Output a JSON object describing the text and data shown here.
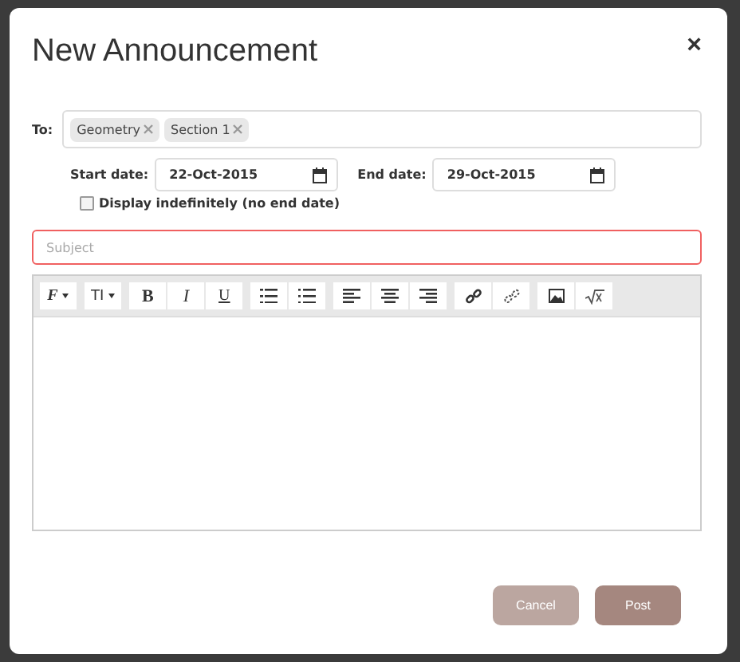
{
  "dialog": {
    "title": "New Announcement",
    "close": "×"
  },
  "to": {
    "label": "To:",
    "tokens": [
      {
        "text": "Geometry"
      },
      {
        "text": "Section 1"
      }
    ]
  },
  "start_date": {
    "label": "Start date:",
    "value": "22-Oct-2015"
  },
  "end_date": {
    "label": "End date:",
    "value": "29-Oct-2015"
  },
  "indefinite": {
    "label": "Display indefinitely (no end date)",
    "checked": false
  },
  "subject": {
    "placeholder": "Subject",
    "invalid": true
  },
  "toolbar": [
    {
      "label": "F",
      "dropdown": true
    },
    {
      "label": "TI",
      "dropdown": true
    },
    {
      "label": "B",
      "dropdown": false
    },
    {
      "label": "I",
      "dropdown": false
    },
    {
      "label": "U",
      "dropdown": false
    }
  ],
  "buttons": [
    {
      "label": "Cancel",
      "kind": "secondary"
    },
    {
      "label": "Post",
      "kind": "primary"
    }
  ]
}
